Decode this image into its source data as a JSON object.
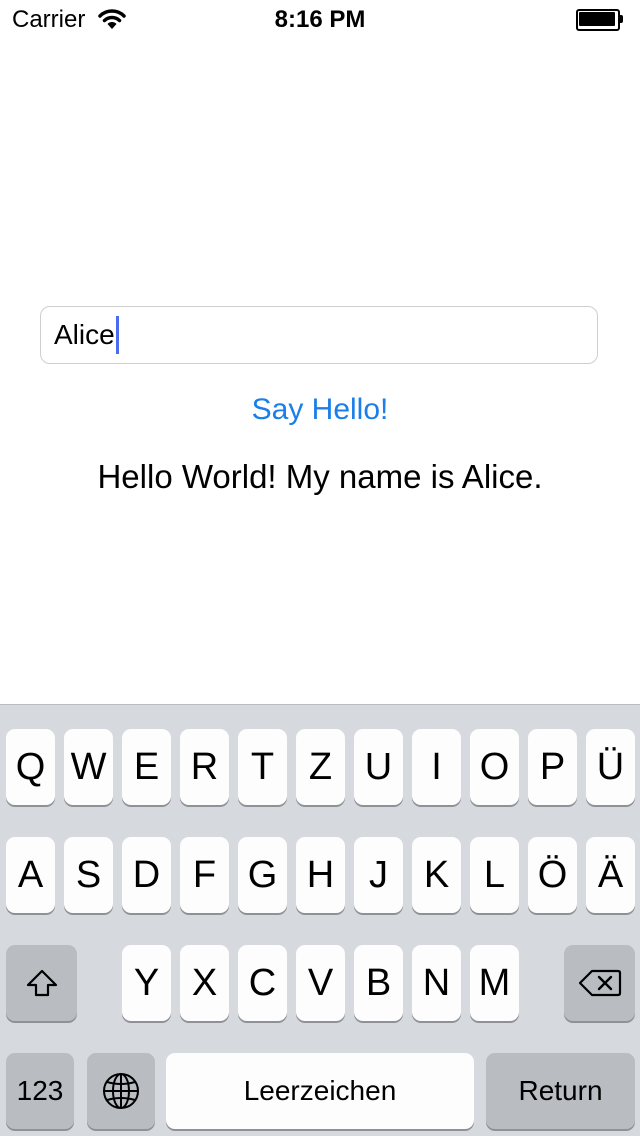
{
  "status_bar": {
    "carrier": "Carrier",
    "time": "8:16 PM"
  },
  "form": {
    "name_value": "Alice",
    "say_hello_label": "Say Hello!",
    "greeting": "Hello World! My name is Alice."
  },
  "keyboard": {
    "row1": [
      "Q",
      "W",
      "E",
      "R",
      "T",
      "Z",
      "U",
      "I",
      "O",
      "P",
      "Ü"
    ],
    "row2": [
      "A",
      "S",
      "D",
      "F",
      "G",
      "H",
      "J",
      "K",
      "L",
      "Ö",
      "Ä"
    ],
    "row3": [
      "Y",
      "X",
      "C",
      "V",
      "B",
      "N",
      "M"
    ],
    "numbers_label": "123",
    "space_label": "Leerzeichen",
    "return_label": "Return",
    "shift_icon": "shift-icon",
    "globe_icon": "globe-icon",
    "backspace_icon": "backspace-icon"
  }
}
